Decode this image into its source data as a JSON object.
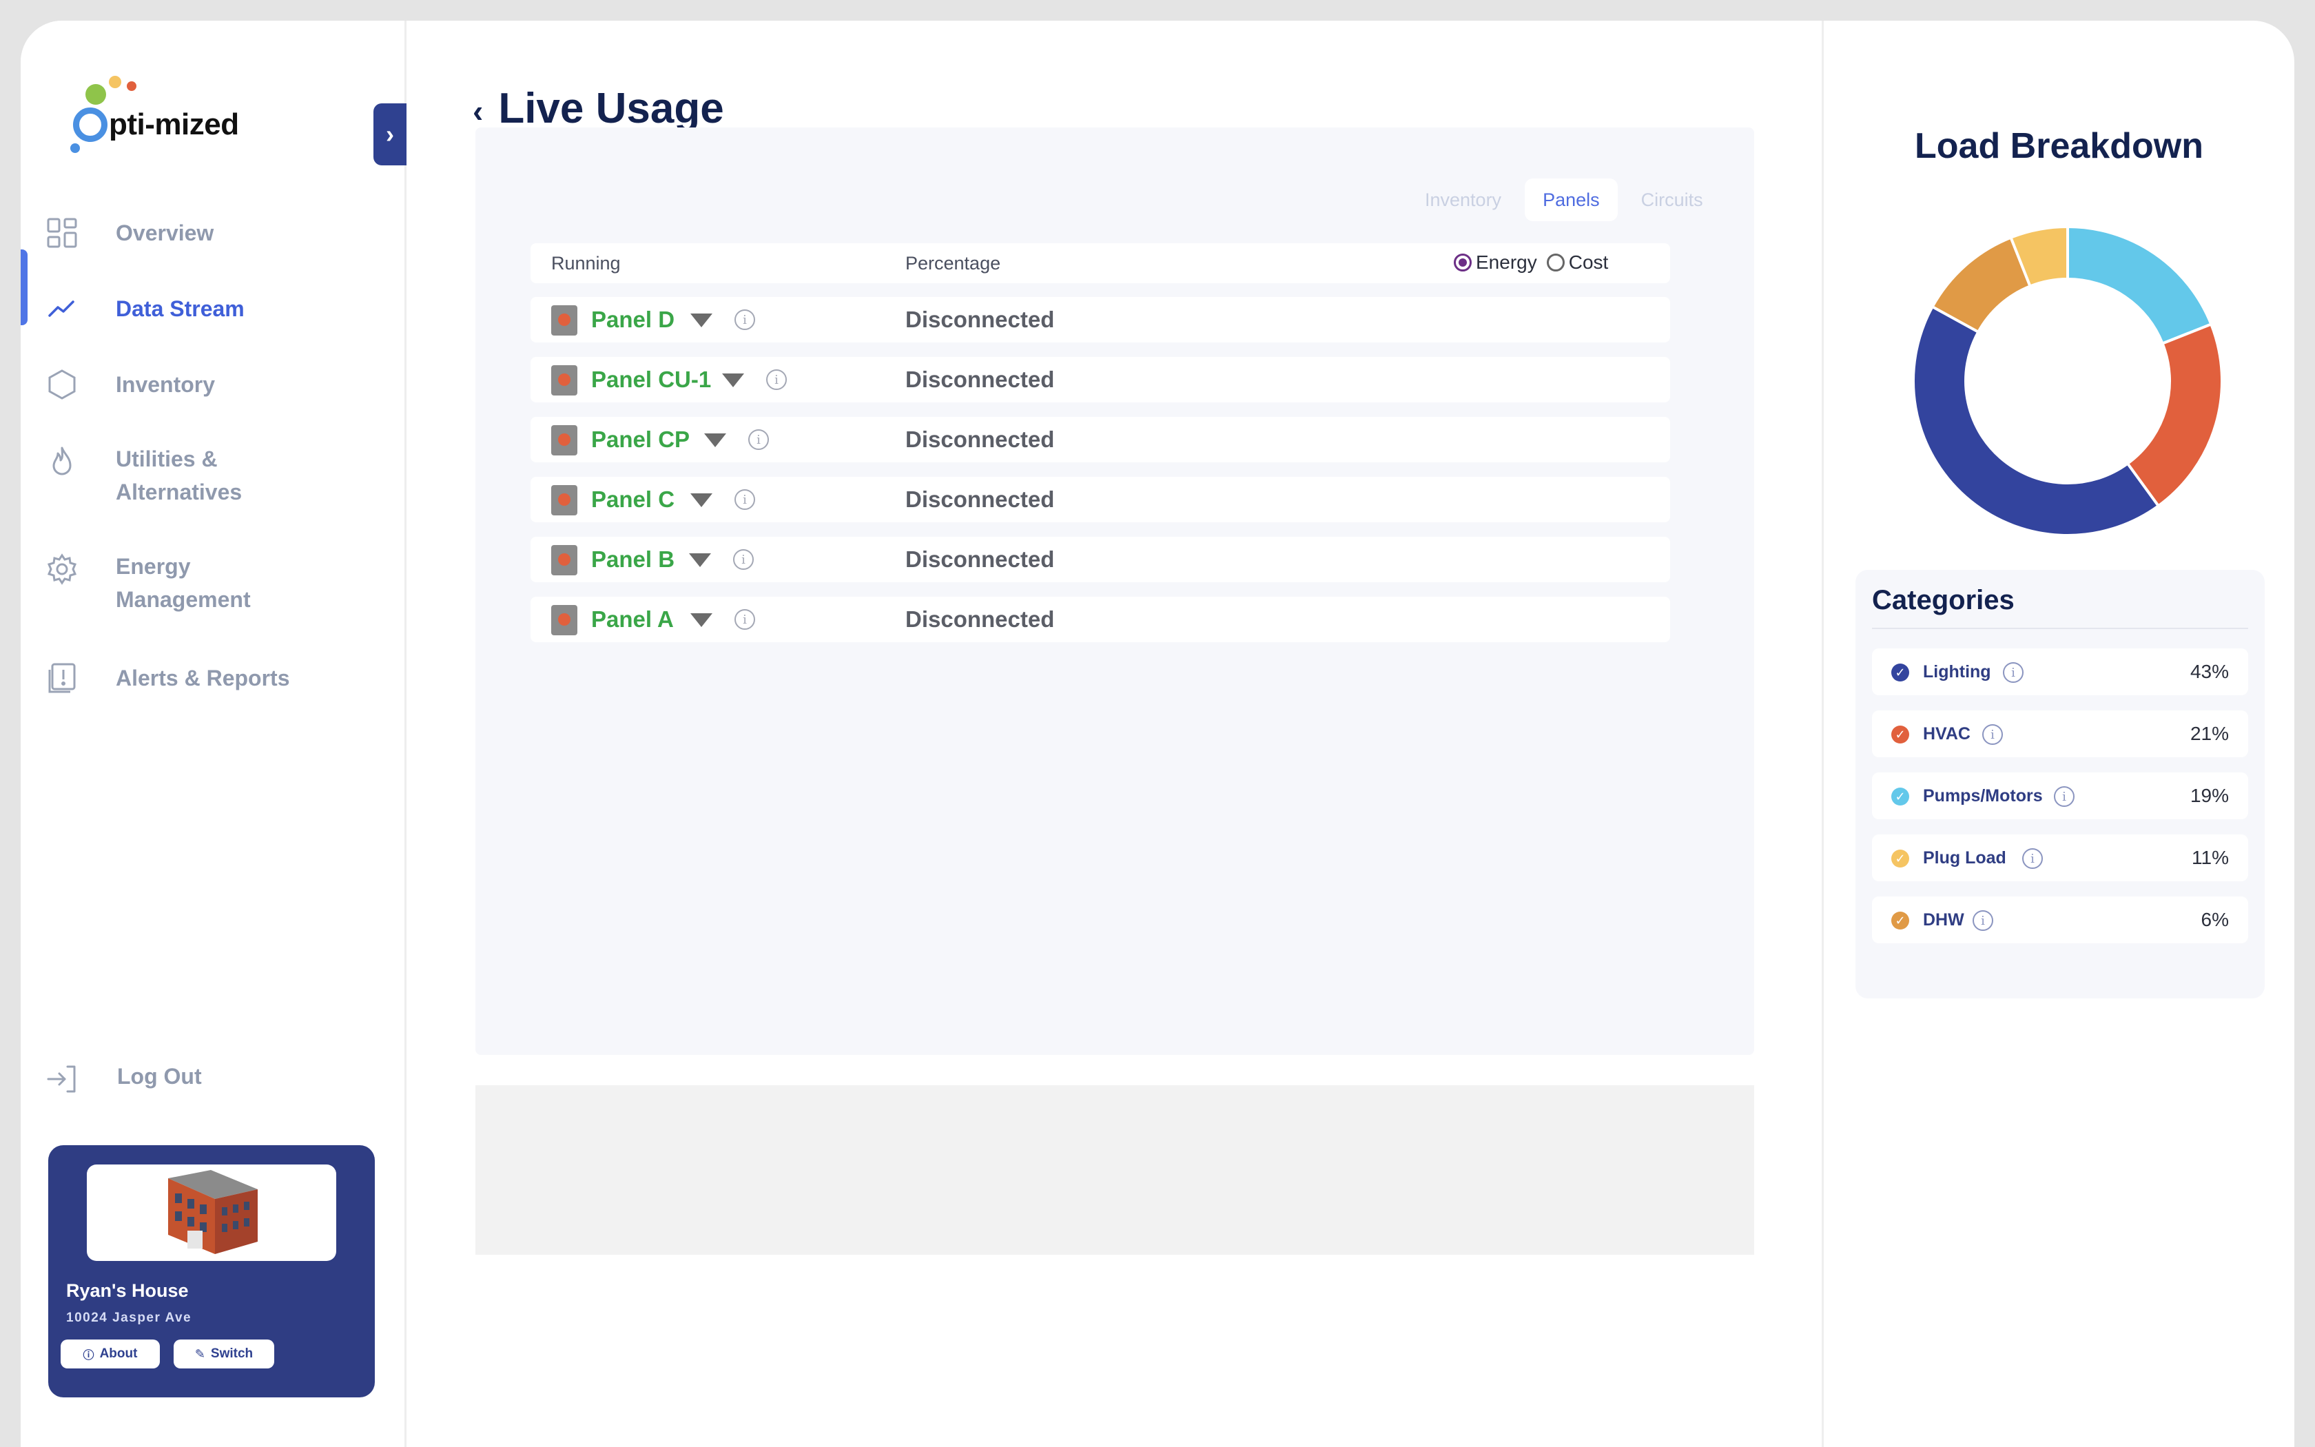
{
  "brand": {
    "name": "Opti-mized",
    "logo_text": "pti-mized"
  },
  "sidebar": {
    "items": [
      {
        "label": "Overview",
        "icon": "grid-icon"
      },
      {
        "label": "Data Stream",
        "icon": "trend-line-icon",
        "active": true
      },
      {
        "label": "Inventory",
        "icon": "hexagon-icon"
      },
      {
        "label": "Utilities &\nAlternatives",
        "icon": "flame-icon"
      },
      {
        "label": "Energy\nManagement",
        "icon": "gear-icon"
      },
      {
        "label": "Alerts & Reports",
        "icon": "report-alert-icon"
      }
    ],
    "logout": "Log Out",
    "collapse_icon": "chevron-right-icon"
  },
  "building_card": {
    "name": "Ryan's House",
    "address": "10024 Jasper Ave",
    "about_label": "About",
    "switch_label": "Switch"
  },
  "main": {
    "title": "Live Usage",
    "tabs": [
      {
        "label": "Inventory"
      },
      {
        "label": "Panels",
        "selected": true
      },
      {
        "label": "Circuits"
      }
    ],
    "table": {
      "col_running": "Running",
      "col_percentage": "Percentage",
      "radio": [
        {
          "label": "Energy",
          "checked": true
        },
        {
          "label": "Cost",
          "checked": false
        }
      ],
      "rows": [
        {
          "name": "Panel D",
          "value": "Disconnected"
        },
        {
          "name": "Panel CU-1",
          "value": "Disconnected"
        },
        {
          "name": "Panel CP",
          "value": "Disconnected"
        },
        {
          "name": "Panel C",
          "value": "Disconnected"
        },
        {
          "name": "Panel B",
          "value": "Disconnected"
        },
        {
          "name": "Panel A",
          "value": "Disconnected"
        }
      ]
    }
  },
  "load_breakdown": {
    "title": "Load Breakdown",
    "categories_title": "Categories",
    "categories": [
      {
        "name": "Lighting",
        "pct": "43%",
        "value": 43,
        "color": "#33449e"
      },
      {
        "name": "HVAC",
        "pct": "21%",
        "value": 21,
        "color": "#e1603d"
      },
      {
        "name": "Pumps/Motors",
        "pct": "19%",
        "value": 19,
        "color": "#63c8ea"
      },
      {
        "name": "Plug Load",
        "pct": "11%",
        "value": 11,
        "color": "#f5c462"
      },
      {
        "name": "DHW",
        "pct": "6%",
        "value": 6,
        "color": "#e09a46"
      }
    ]
  },
  "chart_data": {
    "type": "pie",
    "categories": [
      "Pumps/Motors",
      "HVAC",
      "Lighting",
      "DHW",
      "Plug Load"
    ],
    "values": [
      19,
      21,
      43,
      11,
      6
    ],
    "colors": [
      "#63c8ea",
      "#e1603d",
      "#33449e",
      "#e09a46",
      "#f5c462"
    ],
    "title": "Load Breakdown",
    "donut": true
  }
}
